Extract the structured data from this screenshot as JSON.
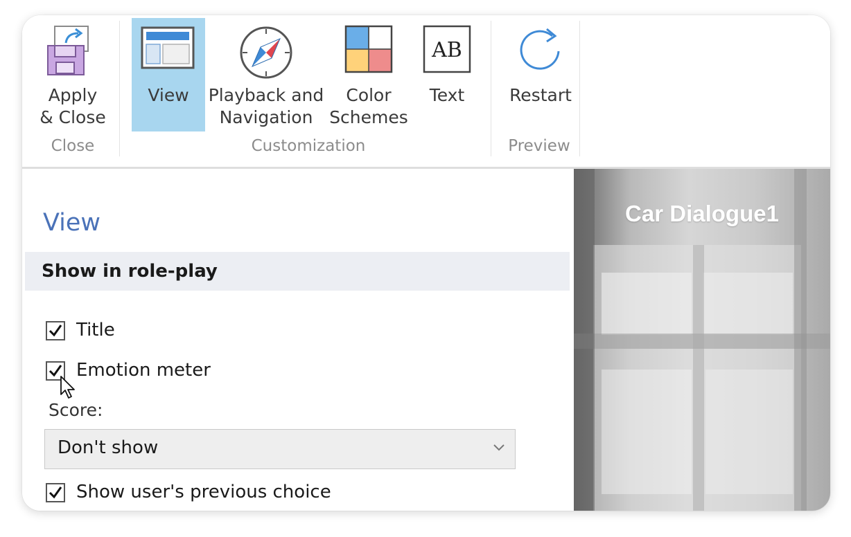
{
  "ribbon": {
    "groups": {
      "close": "Close",
      "customization": "Customization",
      "preview": "Preview"
    },
    "buttons": {
      "apply_close": "Apply\n& Close",
      "view": "View",
      "playback": "Playback and\nNavigation",
      "color_schemes": "Color\nSchemes",
      "text": "Text",
      "restart": "Restart"
    },
    "text_icon_glyph": "AB",
    "selected_color": "#a8d6ef"
  },
  "panel": {
    "title": "View",
    "section_header": "Show in role-play",
    "options": {
      "title": {
        "label": "Title",
        "checked": true
      },
      "emotion_meter": {
        "label": "Emotion meter",
        "checked": true
      },
      "previous_choice": {
        "label": "Show user's previous choice",
        "checked": true
      }
    },
    "score": {
      "label": "Score:",
      "selected": "Don't show"
    }
  },
  "preview": {
    "title": "Car Dialogue1"
  },
  "colors": {
    "accent_title": "#4a72b8",
    "section_header_bg": "#eceef3"
  }
}
